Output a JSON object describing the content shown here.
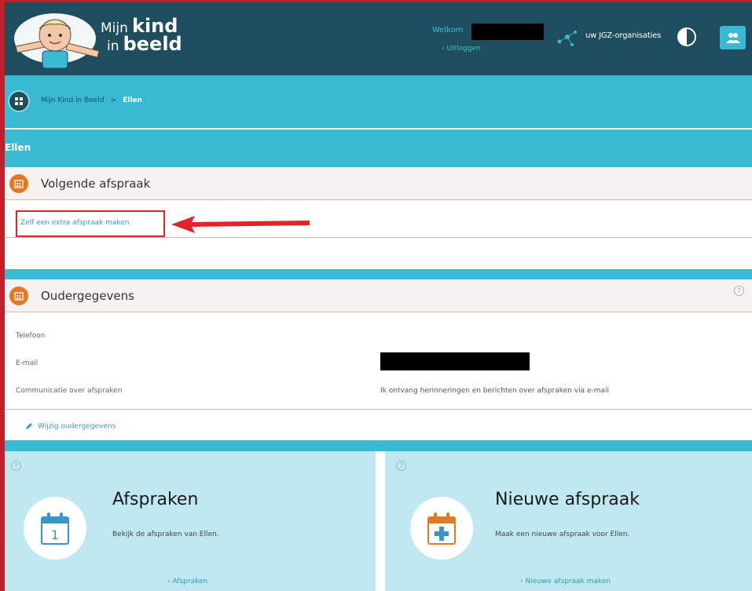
{
  "header": {
    "logo_line1": "Mijn",
    "logo_word1": "kind",
    "logo_line2": "in",
    "logo_word2": "beeld",
    "welcome": "Welkom",
    "logout": "› Uitloggen",
    "jgz_label": "uw JGZ-organisaties"
  },
  "breadcrumb": {
    "home": "Mijn Kind in Beeld",
    "separator": ">",
    "current": "Ellen"
  },
  "page_title": "Ellen",
  "next_appointment": {
    "title": "Volgende afspraak",
    "extra_link": "Zelf een extra afspraak maken"
  },
  "parent_data": {
    "title": "Oudergegevens",
    "help": "?",
    "rows": [
      {
        "label": "Telefoon",
        "value": ""
      },
      {
        "label": "E-mail",
        "value": ""
      },
      {
        "label": "Communicatie over afspraken",
        "value": "Ik ontvang herinneringen en berichten over afspraken via e-mail"
      }
    ],
    "edit_link": "Wijzig oudergegevens"
  },
  "tiles": [
    {
      "help": "?",
      "title": "Afspraken",
      "desc": "Bekijk de afspraken van Ellen.",
      "link": "› Afspraken"
    },
    {
      "help": "?",
      "title": "Nieuwe afspraak",
      "desc": "Maak een nieuwe afspraak voor Ellen.",
      "link": "› Nieuwe afspraak maken"
    }
  ],
  "colors": {
    "header": "#1e4d5d",
    "accent_blue": "#3ab9d4",
    "tile_bg": "#bfe8f0",
    "section_icon": "#e07a24",
    "annotation_red": "#e0242a"
  },
  "icons": {
    "logo": "child-mascot-icon",
    "network": "network-icon",
    "contrast": "contrast-icon",
    "people": "people-icon",
    "grid": "grid-icon",
    "calendar": "calendar-icon",
    "edit": "pencil-icon"
  }
}
